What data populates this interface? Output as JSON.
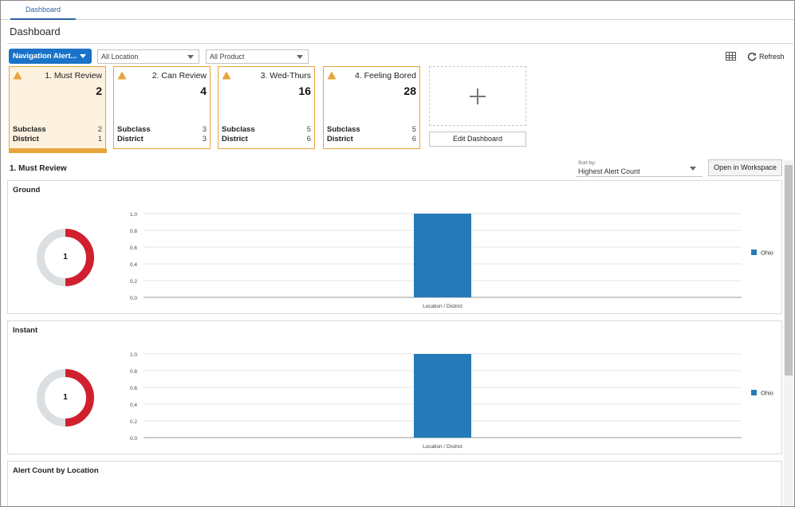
{
  "tabs": [
    {
      "label": "Dashboard"
    }
  ],
  "page": {
    "title": "Dashboard"
  },
  "toolbar": {
    "nav_button": "Navigation Alert...",
    "location_select": "All Location",
    "product_select": "All Product",
    "refresh_label": "Refresh"
  },
  "tiles": [
    {
      "name": "1. Must Review",
      "count": "2",
      "rows": [
        {
          "label": "Subclass",
          "value": "2"
        },
        {
          "label": "District",
          "value": "1"
        }
      ]
    },
    {
      "name": "2. Can Review",
      "count": "4",
      "rows": [
        {
          "label": "Subclass",
          "value": "3"
        },
        {
          "label": "District",
          "value": "3"
        }
      ]
    },
    {
      "name": "3. Wed-Thurs",
      "count": "16",
      "rows": [
        {
          "label": "Subclass",
          "value": "5"
        },
        {
          "label": "District",
          "value": "6"
        }
      ]
    },
    {
      "name": "4. Feeling Bored",
      "count": "28",
      "rows": [
        {
          "label": "Subclass",
          "value": "5"
        },
        {
          "label": "District",
          "value": "6"
        }
      ]
    }
  ],
  "edit_dashboard_label": "Edit Dashboard",
  "section": {
    "title": "1. Must Review",
    "sort_label": "Sort by:",
    "sort_value": "Highest Alert Count",
    "open_label": "Open in Workspace"
  },
  "colors": {
    "accent": "#1a73c8",
    "alert": "#e7a43a",
    "donut_fill": "#d0202e",
    "donut_track": "#dcdfe2",
    "bar": "#247bb8"
  },
  "panels": [
    {
      "title": "Ground",
      "donut_value": "1",
      "donut_fraction": 0.5
    },
    {
      "title": "Instant",
      "donut_value": "1",
      "donut_fraction": 0.5
    },
    {
      "title": "Alert Count by Location"
    }
  ],
  "chart_data": [
    {
      "type": "bar",
      "categories": [
        "Location / District"
      ],
      "series": [
        {
          "name": "Ohio",
          "values": [
            1.0
          ]
        }
      ],
      "yticks": [
        "0.0",
        "0.2",
        "0.4",
        "0.6",
        "0.8",
        "1.0"
      ],
      "ylim": [
        0,
        1.0
      ],
      "grid": true,
      "legend": "right"
    },
    {
      "type": "bar",
      "categories": [
        "Location / District"
      ],
      "series": [
        {
          "name": "Ohio",
          "values": [
            1.0
          ]
        }
      ],
      "yticks": [
        "0.0",
        "0.2",
        "0.4",
        "0.6",
        "0.8",
        "1.0"
      ],
      "ylim": [
        0,
        1.0
      ],
      "grid": true,
      "legend": "right"
    }
  ]
}
